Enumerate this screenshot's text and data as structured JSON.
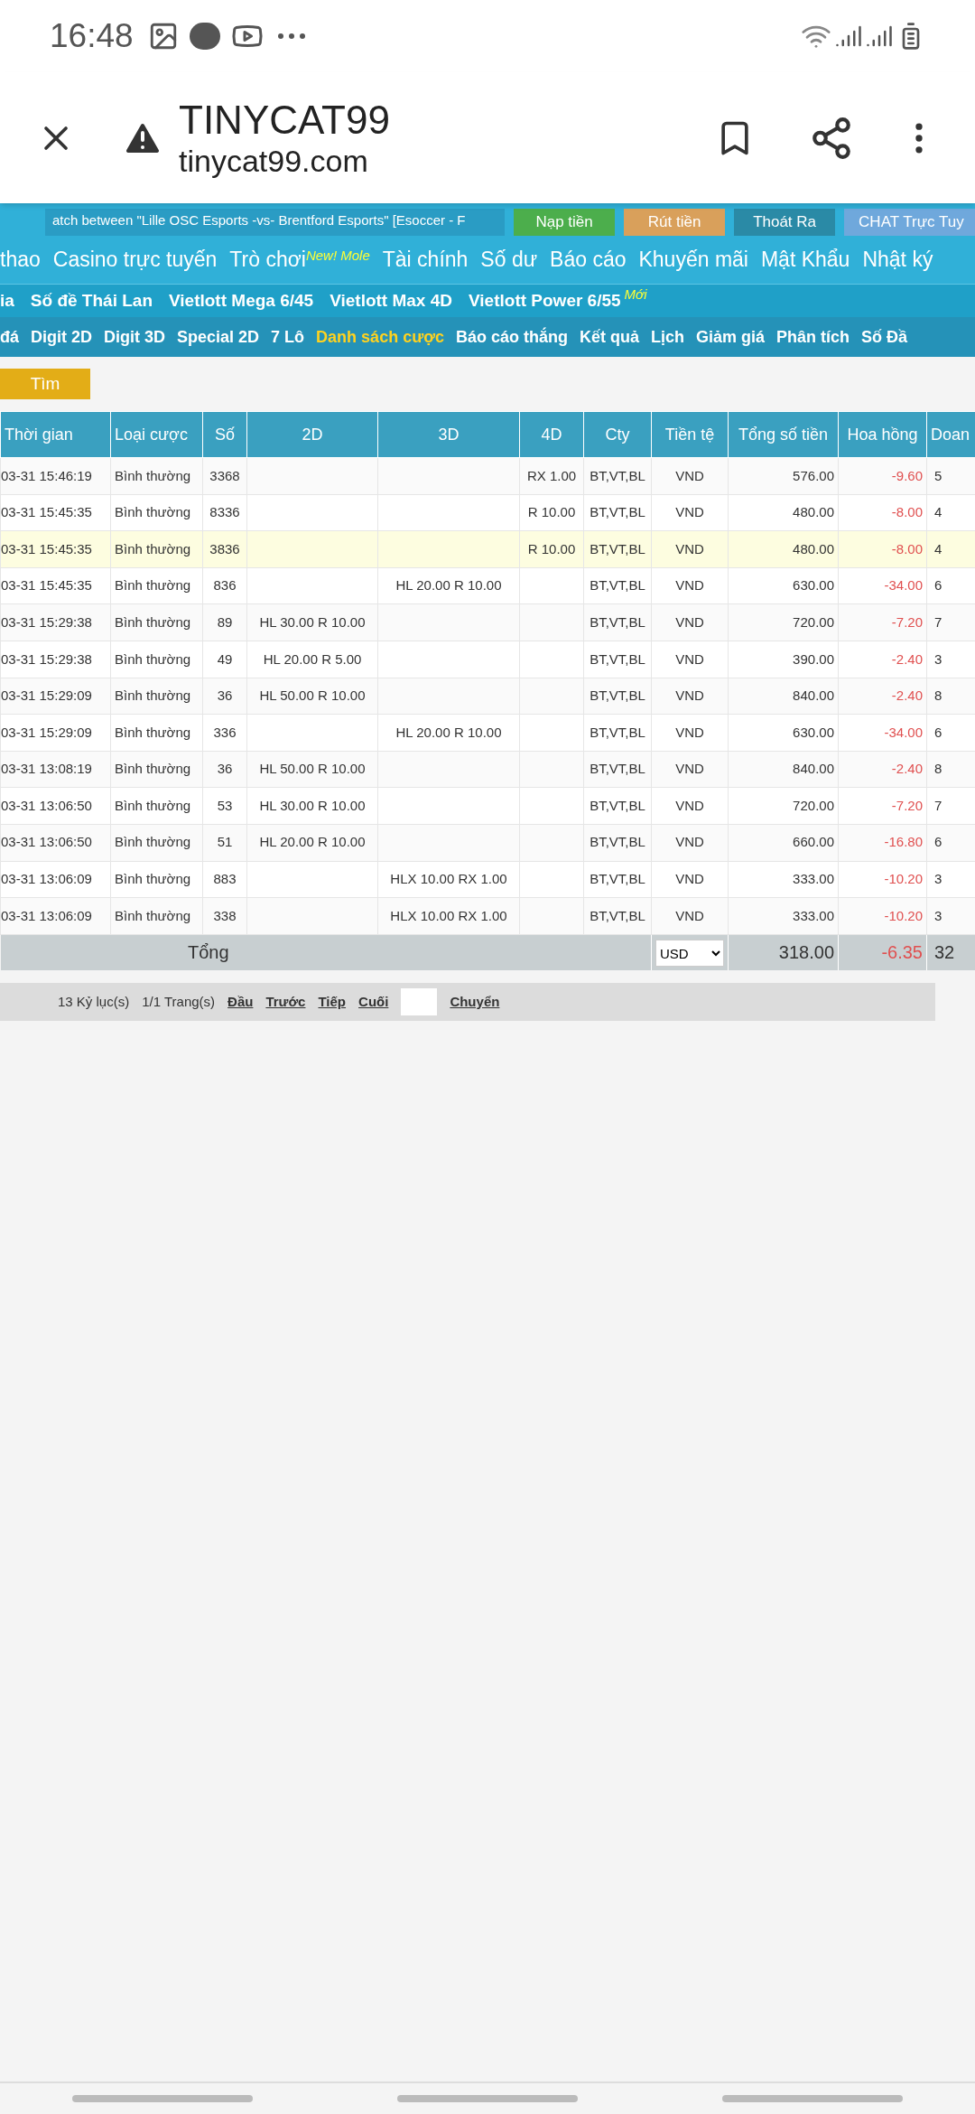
{
  "status_bar": {
    "time": "16:48"
  },
  "browser": {
    "title": "TINYCAT99",
    "url": "tinycat99.com"
  },
  "banner": {
    "marquee": "atch between \"Lille OSC Esports -vs- Brentford Esports\" [Esoccer - F",
    "buttons": [
      {
        "label": "Nạp tiền",
        "color": "#4cae4c"
      },
      {
        "label": "Rút tiền",
        "color": "#d9a05b"
      },
      {
        "label": "Thoát Ra",
        "color": "#2a8aa6"
      },
      {
        "label": "CHAT Trực Tuy",
        "color": "#6fa8dc"
      }
    ]
  },
  "nav_main": [
    {
      "label": "thao"
    },
    {
      "label": "Casino trực tuyến"
    },
    {
      "label": "Trò chơi",
      "sup": "New! Mole"
    },
    {
      "label": "Tài chính"
    },
    {
      "label": "Số dư"
    },
    {
      "label": "Báo cáo"
    },
    {
      "label": "Khuyến mãi"
    },
    {
      "label": "Mật Khẩu"
    },
    {
      "label": "Nhật ký"
    }
  ],
  "nav_lottery": [
    {
      "label": "ia"
    },
    {
      "label": "Số đề Thái Lan"
    },
    {
      "label": "Vietlott Mega 6/45"
    },
    {
      "label": "Vietlott Max 4D"
    },
    {
      "label": "Vietlott Power 6/55",
      "sup": "Mới"
    }
  ],
  "nav_sub": [
    {
      "label": "đá",
      "selected": false
    },
    {
      "label": "Digit 2D",
      "selected": false
    },
    {
      "label": "Digit 3D",
      "selected": false
    },
    {
      "label": "Special 2D",
      "selected": false
    },
    {
      "label": "7 Lô",
      "selected": false
    },
    {
      "label": "Danh sách cược",
      "selected": true
    },
    {
      "label": "Báo cáo thắng",
      "selected": false
    },
    {
      "label": "Kết quả",
      "selected": false
    },
    {
      "label": "Lịch",
      "selected": false
    },
    {
      "label": "Giảm giá",
      "selected": false
    },
    {
      "label": "Phân tích",
      "selected": false
    },
    {
      "label": "Số Đầ",
      "selected": false
    }
  ],
  "search_button": "Tìm",
  "table": {
    "columns": [
      "Thời gian",
      "Loại cược",
      "Số",
      "2D",
      "3D",
      "4D",
      "Cty",
      "Tiền tệ",
      "Tổng số tiền",
      "Hoa hồng",
      "Doan"
    ],
    "rows": [
      {
        "selected": false,
        "cells": [
          "03-31 15:46:19",
          "Bình thường",
          "3368",
          "",
          "",
          "RX 1.00",
          "BT,VT,BL",
          "VND",
          "576.00",
          "-9.60",
          "5"
        ]
      },
      {
        "selected": false,
        "cells": [
          "03-31 15:45:35",
          "Bình thường",
          "8336",
          "",
          "",
          "R 10.00",
          "BT,VT,BL",
          "VND",
          "480.00",
          "-8.00",
          "4"
        ]
      },
      {
        "selected": true,
        "cells": [
          "03-31 15:45:35",
          "Bình thường",
          "3836",
          "",
          "",
          "R 10.00",
          "BT,VT,BL",
          "VND",
          "480.00",
          "-8.00",
          "4"
        ]
      },
      {
        "selected": false,
        "cells": [
          "03-31 15:45:35",
          "Bình thường",
          "836",
          "",
          "HL 20.00 R 10.00",
          "",
          "BT,VT,BL",
          "VND",
          "630.00",
          "-34.00",
          "6"
        ]
      },
      {
        "selected": false,
        "cells": [
          "03-31 15:29:38",
          "Bình thường",
          "89",
          "HL 30.00 R 10.00",
          "",
          "",
          "BT,VT,BL",
          "VND",
          "720.00",
          "-7.20",
          "7"
        ]
      },
      {
        "selected": false,
        "cells": [
          "03-31 15:29:38",
          "Bình thường",
          "49",
          "HL 20.00 R 5.00",
          "",
          "",
          "BT,VT,BL",
          "VND",
          "390.00",
          "-2.40",
          "3"
        ]
      },
      {
        "selected": false,
        "cells": [
          "03-31 15:29:09",
          "Bình thường",
          "36",
          "HL 50.00 R 10.00",
          "",
          "",
          "BT,VT,BL",
          "VND",
          "840.00",
          "-2.40",
          "8"
        ]
      },
      {
        "selected": false,
        "cells": [
          "03-31 15:29:09",
          "Bình thường",
          "336",
          "",
          "HL 20.00 R 10.00",
          "",
          "BT,VT,BL",
          "VND",
          "630.00",
          "-34.00",
          "6"
        ]
      },
      {
        "selected": false,
        "cells": [
          "03-31 13:08:19",
          "Bình thường",
          "36",
          "HL 50.00 R 10.00",
          "",
          "",
          "BT,VT,BL",
          "VND",
          "840.00",
          "-2.40",
          "8"
        ]
      },
      {
        "selected": false,
        "cells": [
          "03-31 13:06:50",
          "Bình thường",
          "53",
          "HL 30.00 R 10.00",
          "",
          "",
          "BT,VT,BL",
          "VND",
          "720.00",
          "-7.20",
          "7"
        ]
      },
      {
        "selected": false,
        "cells": [
          "03-31 13:06:50",
          "Bình thường",
          "51",
          "HL 20.00 R 10.00",
          "",
          "",
          "BT,VT,BL",
          "VND",
          "660.00",
          "-16.80",
          "6"
        ]
      },
      {
        "selected": false,
        "cells": [
          "03-31 13:06:09",
          "Bình thường",
          "883",
          "",
          "HLX 10.00 RX 1.00",
          "",
          "BT,VT,BL",
          "VND",
          "333.00",
          "-10.20",
          "3"
        ]
      },
      {
        "selected": false,
        "cells": [
          "03-31 13:06:09",
          "Bình thường",
          "338",
          "",
          "HLX 10.00 RX 1.00",
          "",
          "BT,VT,BL",
          "VND",
          "333.00",
          "-10.20",
          "3"
        ]
      }
    ],
    "total": {
      "label": "Tổng",
      "currency": "USD",
      "amount": "318.00",
      "commission": "-6.35",
      "column_11": "32"
    }
  },
  "pagination": {
    "records": "13 Kỷ lục(s)",
    "pages": "1/1 Trang(s)",
    "links": [
      "Đầu",
      "Trước",
      "Tiếp",
      "Cuối"
    ],
    "go": "Chuyển"
  }
}
